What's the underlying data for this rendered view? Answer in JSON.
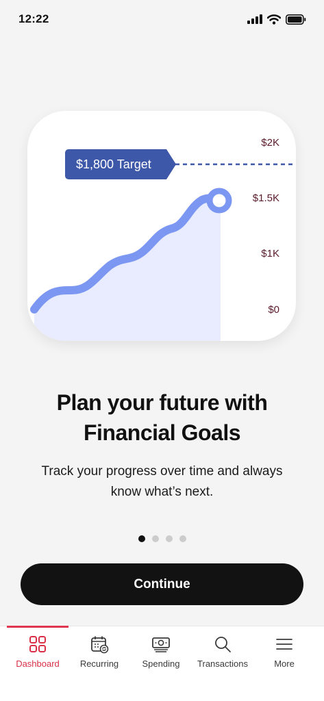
{
  "status_bar": {
    "time": "12:22"
  },
  "chart_card": {
    "target_label": "$1,800 Target",
    "y_ticks": [
      "$2K",
      "$1.5K",
      "$1K",
      "$0"
    ],
    "accent_color": "#3d58a8",
    "line_color": "#7b97f2",
    "fill_color": "#e9ecff"
  },
  "headline": {
    "line1": "Plan your future with",
    "line2": "Financial Goals"
  },
  "subtext": {
    "line1": "Track your progress over time and always",
    "line2": "know what’s next."
  },
  "pager": {
    "total": 4,
    "active": 1
  },
  "continue_button": {
    "label": "Continue"
  },
  "tabbar": {
    "active_color": "#d92f47",
    "tabs": [
      {
        "label": "Dashboard",
        "icon": "dashboard-grid-icon",
        "active": true
      },
      {
        "label": "Recurring",
        "icon": "recurring-calendar-icon",
        "active": false
      },
      {
        "label": "Spending",
        "icon": "spending-cash-icon",
        "active": false
      },
      {
        "label": "Transactions",
        "icon": "search-icon",
        "active": false
      },
      {
        "label": "More",
        "icon": "hamburger-menu-icon",
        "active": false
      }
    ]
  }
}
